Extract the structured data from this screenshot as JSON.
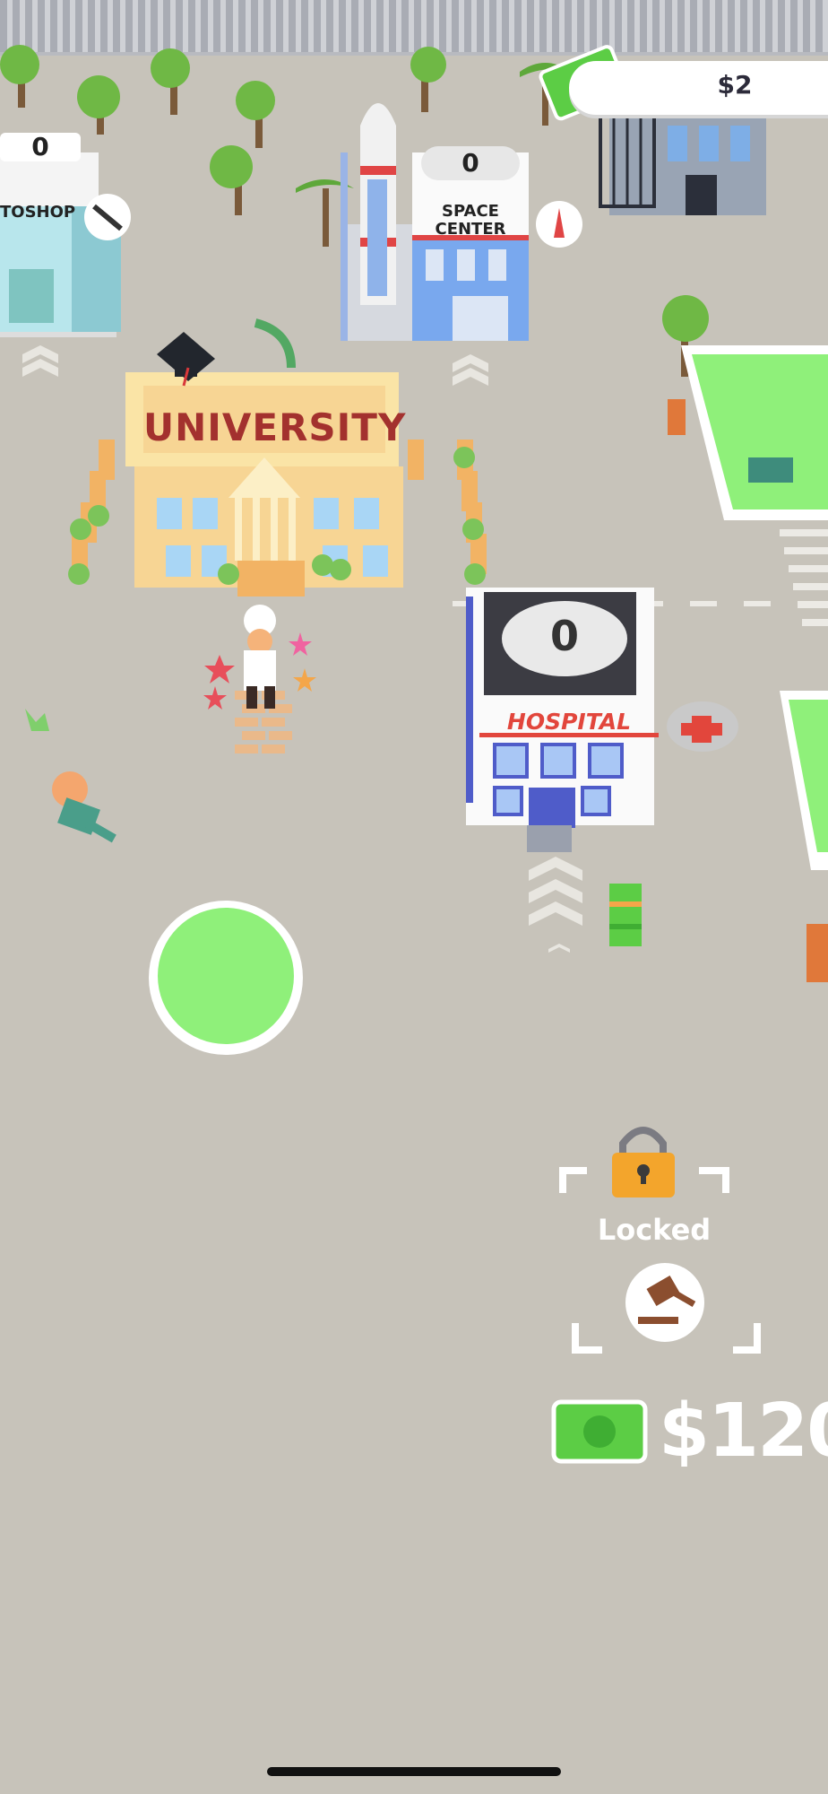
{
  "hud": {
    "money": "$2",
    "money_icon": "cash-icon"
  },
  "buildings": {
    "photoshop": {
      "label": "TOSHOP",
      "visitors": "0",
      "icon": "wrench-icon"
    },
    "space_center": {
      "label_line1": "SPACE",
      "label_line2": "CENTER",
      "visitors": "0",
      "icon": "rocket-icon"
    },
    "university": {
      "label": "UNIVERSITY"
    },
    "hospital": {
      "label": "HOSPITAL",
      "visitors": "0",
      "icon": "red-cross-icon"
    }
  },
  "locked_plot": {
    "status": "Locked",
    "icon": "gavel-icon",
    "price": "$120"
  },
  "colors": {
    "ground": "#c7c3ba",
    "grass": "#8ff07a",
    "money_green": "#5ccd45",
    "hospital_red": "#e2463c",
    "lock_orange": "#f3a52c"
  }
}
